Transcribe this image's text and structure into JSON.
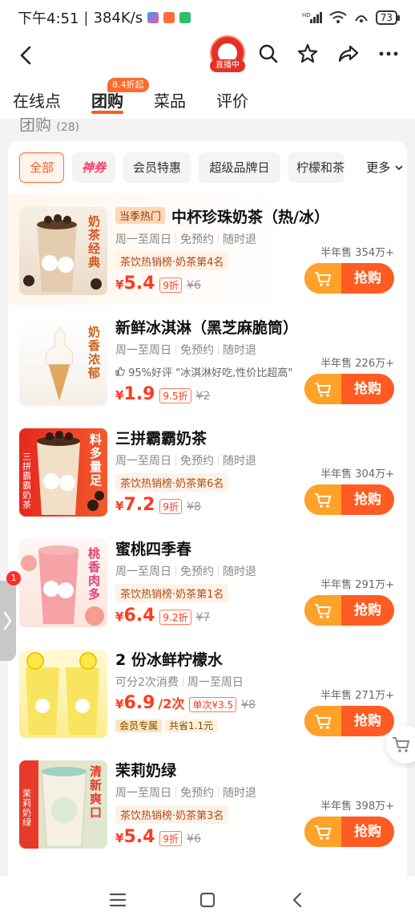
{
  "status_bar": {
    "time": "下午4:51",
    "speed": "384K/s",
    "battery": "73"
  },
  "header": {
    "live_label": "直播中"
  },
  "tabs": [
    {
      "label": "在线点"
    },
    {
      "label": "团购"
    },
    {
      "label": "菜品"
    },
    {
      "label": "评价"
    }
  ],
  "tab_tag": "8.4折起",
  "section": {
    "title": "团购",
    "count": "(28)"
  },
  "filters": [
    {
      "label": "全部"
    },
    {
      "label": "神券"
    },
    {
      "label": "会员特惠"
    },
    {
      "label": "超级品牌日"
    },
    {
      "label": "柠檬和茶"
    }
  ],
  "filter_more": "更多",
  "products": [
    {
      "tag": "当季热门",
      "title": "中杯珍珠奶茶（热/冰）",
      "meta": [
        "周一至周日",
        "免预约",
        "随时退"
      ],
      "badge": "茶饮热销榜·奶茶第4名",
      "price": "5.4",
      "discount": "9折",
      "original": "¥6",
      "sold": "半年售 354万+",
      "buy": "抢购",
      "thumb_text": "奶茶经典"
    },
    {
      "title": "新鲜冰淇淋（黑芝麻脆筒）",
      "meta": [
        "周一至周日",
        "免预约",
        "随时退"
      ],
      "review": "95%好评 \"冰淇淋好吃,性价比超高\"",
      "price": "1.9",
      "discount": "9.5折",
      "original": "¥2",
      "sold": "半年售 226万+",
      "buy": "抢购",
      "thumb_text": "奶香浓郁"
    },
    {
      "title": "三拼霸霸奶茶",
      "meta": [
        "周一至周日",
        "免预约",
        "随时退"
      ],
      "badge": "茶饮热销榜·奶茶第6名",
      "price": "7.2",
      "discount": "9折",
      "original": "¥8",
      "sold": "半年售 304万+",
      "buy": "抢购",
      "thumb_text": "料多量足",
      "thumb_side": "三拼霸霸奶茶"
    },
    {
      "title": "蜜桃四季春",
      "meta": [
        "周一至周日",
        "免预约",
        "随时退"
      ],
      "badge": "茶饮热销榜·奶茶第1名",
      "price": "6.4",
      "discount": "9.2折",
      "original": "¥7",
      "sold": "半年售 291万+",
      "buy": "抢购",
      "thumb_text": "桃香肉多"
    },
    {
      "title": "2 份冰鲜柠檬水",
      "meta": [
        "可分2次消费",
        "周一至周日"
      ],
      "price": "6.9",
      "per": "/2次",
      "single": "单次¥3.5",
      "original": "¥8",
      "member1": "会员专属",
      "member2": "共省1.1元",
      "sold": "半年售 271万+",
      "buy": "抢购"
    },
    {
      "title": "茉莉奶绿",
      "meta": [
        "周一至周日",
        "免预约",
        "随时退"
      ],
      "badge": "茶饮热销榜·奶茶第3名",
      "price": "5.4",
      "discount": "9折",
      "original": "¥6",
      "sold": "半年售 398万+",
      "buy": "抢购",
      "thumb_text": "清新爽口",
      "thumb_side": "茉莉奶绿"
    }
  ],
  "side_badge": "1",
  "colors": {
    "accent": "#ff5a1f",
    "buy_orange": "#ff5b22",
    "buy_yellow": "#ffa22a"
  }
}
